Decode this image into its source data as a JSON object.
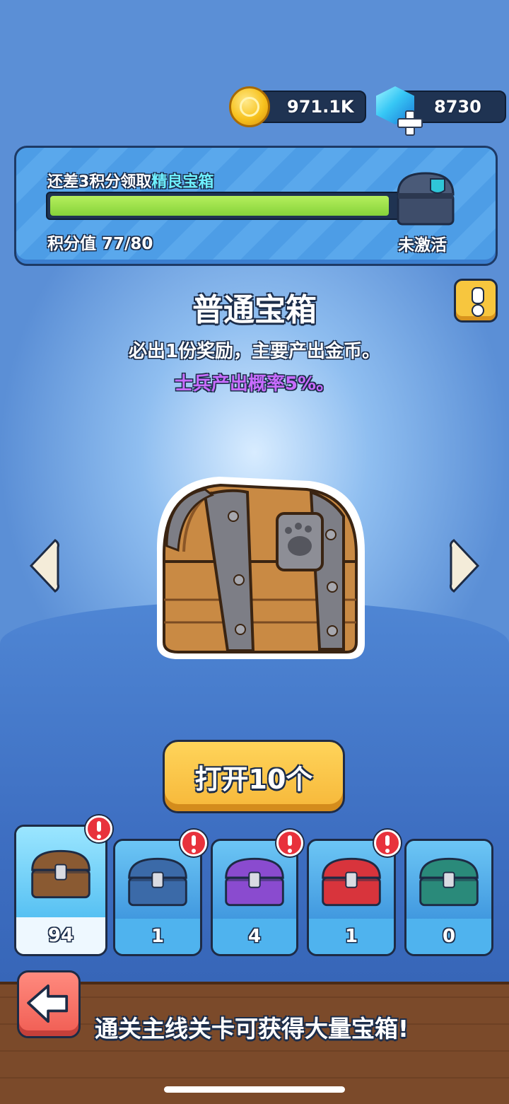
{
  "currency": {
    "coins": "971.1K",
    "gems": "8730"
  },
  "progress": {
    "title_prefix": "还差3积分领取",
    "title_highlight": "精良宝箱",
    "points_label": "积分值 77/80",
    "fraction": 0.9625,
    "status": "未激活"
  },
  "chest": {
    "name": "普通宝箱",
    "description": "必出1份奖励，主要产出金币。",
    "soldier_rate": "士兵产出概率5%。"
  },
  "open_button": "打开10个",
  "chest_slots": [
    {
      "count": "94",
      "alert": true,
      "selected": true,
      "color": "#8a5a32"
    },
    {
      "count": "1",
      "alert": true,
      "selected": false,
      "color": "#3b6aa8"
    },
    {
      "count": "4",
      "alert": true,
      "selected": false,
      "color": "#8a4bcf"
    },
    {
      "count": "1",
      "alert": true,
      "selected": false,
      "color": "#d8343c"
    },
    {
      "count": "0",
      "alert": false,
      "selected": false,
      "color": "#2a8a7a"
    }
  ],
  "footer": {
    "hint": "通关主线关卡可获得大量宝箱!"
  },
  "icons": [
    "gold-coin-icon",
    "gem-icon",
    "plus-icon",
    "info-icon",
    "arrow-left-icon",
    "arrow-right-icon",
    "alert-icon",
    "back-arrow-icon"
  ]
}
